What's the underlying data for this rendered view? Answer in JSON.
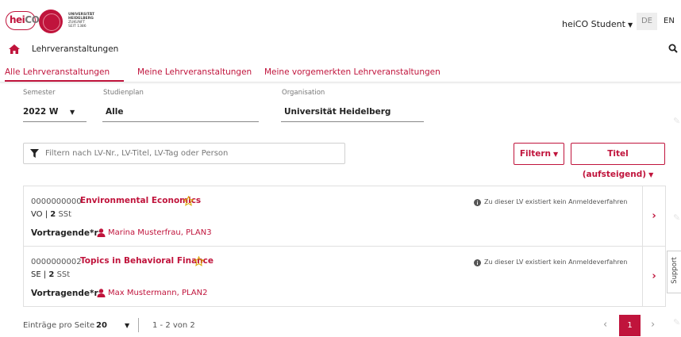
{
  "header": {
    "logo_text_he": "hei",
    "logo_text_co": "CO",
    "uni_lines": [
      "UNIVERSITÄT",
      "HEIDELBERG",
      "ZUKUNFT",
      "SEIT 1386"
    ],
    "user_menu": "heiCO Student",
    "lang_de": "DE",
    "lang_en": "EN"
  },
  "breadcrumb": {
    "title": "Lehrveranstaltungen"
  },
  "tabs": [
    {
      "label": "Alle Lehrveranstaltungen",
      "active": true
    },
    {
      "label": "Meine Lehrveranstaltungen",
      "active": false
    },
    {
      "label": "Meine vorgemerkten Lehrveranstaltungen",
      "active": false
    }
  ],
  "filters": {
    "semester": {
      "label": "Semester",
      "value": "2022 W"
    },
    "studienplan": {
      "label": "Studienplan",
      "value": "Alle"
    },
    "organisation": {
      "label": "Organisation",
      "value": "Universität Heidelberg"
    }
  },
  "search": {
    "placeholder": "Filtern nach LV-Nr., LV-Titel, LV-Tag oder Person",
    "value": ""
  },
  "buttons": {
    "filter": "Filtern",
    "sort": "Titel (aufsteigend)"
  },
  "courses": [
    {
      "code": "0000000000",
      "title": "Environmental Economics",
      "type": "VO",
      "sst_num": "2",
      "sst_unit": "SSt",
      "lecturer_label": "Vortragende*r:",
      "lecturer": "Marina Musterfrau, PLAN3",
      "info": "Zu dieser LV existiert kein Anmeldeverfahren"
    },
    {
      "code": "0000000002",
      "title": "Topics in Behavioral Finance",
      "type": "SE",
      "sst_num": "2",
      "sst_unit": "SSt",
      "lecturer_label": "Vortragende*r:",
      "lecturer": "Max Mustermann, PLAN2",
      "info": "Zu dieser LV existiert kein Anmeldeverfahren"
    }
  ],
  "support": "Support",
  "pagination": {
    "per_page_label": "Einträge pro Seite",
    "per_page_value": "20",
    "range": "1 - 2 von 2",
    "current_page": "1"
  },
  "colors": {
    "accent": "#c0143c"
  }
}
